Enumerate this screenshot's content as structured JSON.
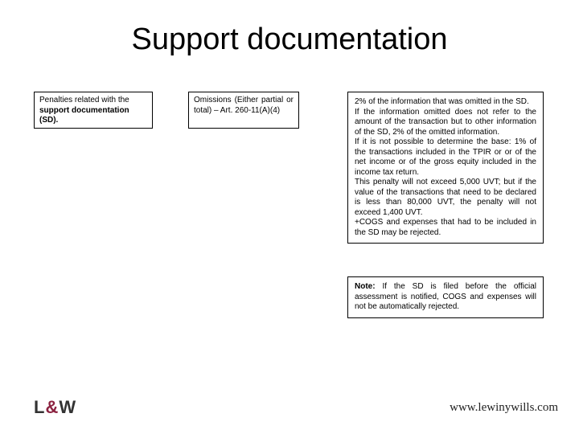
{
  "title": "Support documentation",
  "boxes": {
    "penalties_label_pre": "Penalties related with the ",
    "penalties_label_bold": "support documentation (SD).",
    "omissions": "Omissions (Either partial or total) – Art. 260-11(A)(4)",
    "detail_1": "2% of the information that was omitted in the SD.",
    "detail_2": "If the information omitted does not refer to the amount of the transaction but to other information of the SD, 2% of the omitted information.",
    "detail_3": "If it is not possible to determine the base: 1% of the transactions included in the TPIR or or of the net income or of the gross equity included in the income tax return.",
    "detail_4": "This penalty will not exceed 5,000 UVT; but if the value of the transactions that need to be declared is less than 80,000 UVT, the penalty will not exceed 1,400 UVT.",
    "detail_5": "+COGS and expenses that had to be included in the SD may be rejected.",
    "note_label": "Note:",
    "note_body": " If the SD is filed before the official assessment is notified, COGS and expenses will not be automatically rejected."
  },
  "footer": {
    "logo_l": "L",
    "logo_amp": "&",
    "logo_w": "W",
    "url": "www.lewinywills.com"
  }
}
